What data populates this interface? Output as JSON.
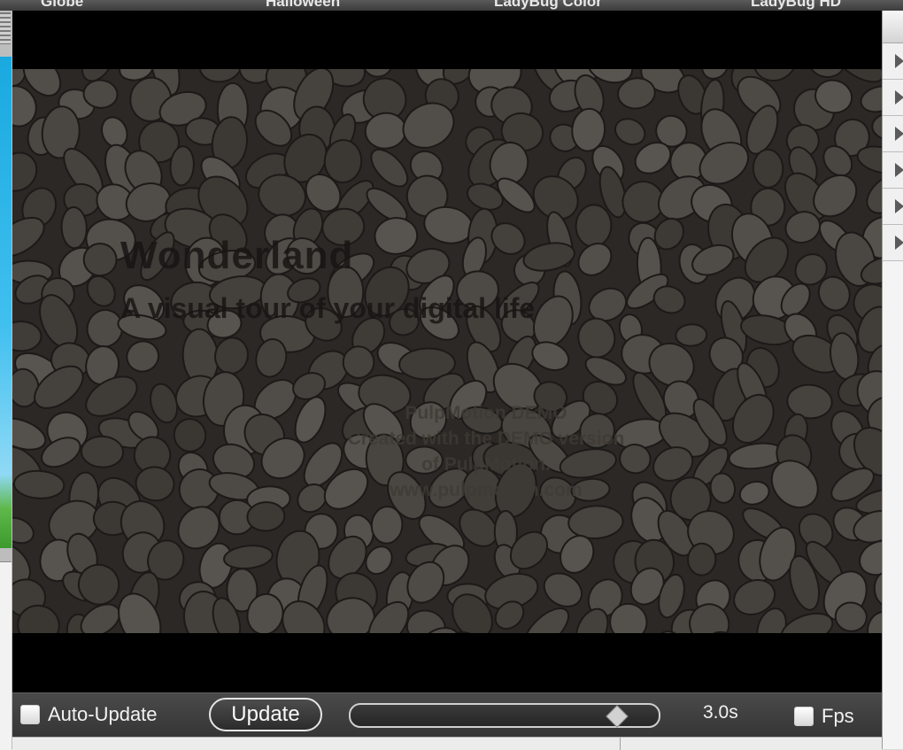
{
  "templates": [
    "Globe",
    "Halloween",
    "LadyBug Color",
    "LadyBug HD"
  ],
  "preview": {
    "title": "Wonderland",
    "subtitle": "A visual tour of your digital life",
    "watermark": [
      "PulpMotion DEMO",
      "Created with the DEMO version",
      "of PulpMotion.",
      "www.pulpmotion.com"
    ]
  },
  "controls": {
    "auto_update_label": "Auto-Update",
    "auto_update_checked": false,
    "update_button": "Update",
    "duration_slider_fraction": 0.9,
    "duration_value": "3.0s",
    "fps_label": "Fps",
    "fps_checked": false
  },
  "colors": {
    "control_bar": "#3f3f3f",
    "preview_background": "#000000",
    "sky_blue": "#19a9e0"
  }
}
